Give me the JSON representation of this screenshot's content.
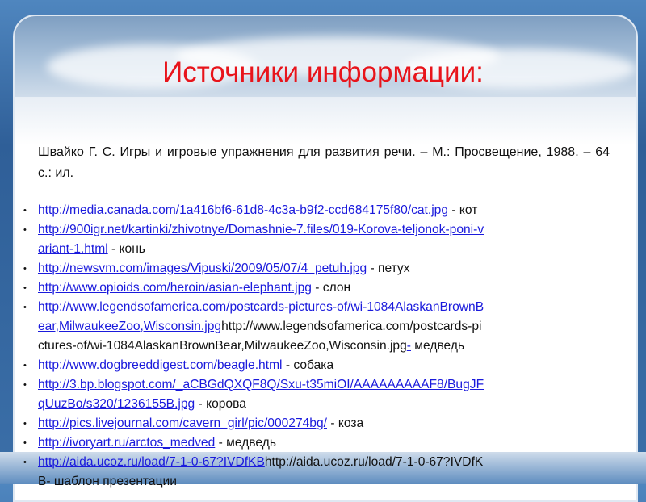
{
  "title": "Источники информации:",
  "reference": "Швайко Г. С.  Игры и игровые упражнения для развития речи. – М.: Просвещение, 1988. – 64 с.: ил.",
  "items": [
    {
      "lines": [
        {
          "link": "http://media.canada.com/1a416bf6-61d8-4c3a-b9f2-ccd684175f80/cat.jpg",
          "text": " - кот"
        }
      ]
    },
    {
      "lines": [
        {
          "link": "http://900igr.net/kartinki/zhivotnye/Domashnie-7.files/019-Korova-teljonok-poni-v",
          "text": ""
        },
        {
          "link": "ariant-1.html",
          "text": " - конь"
        }
      ]
    },
    {
      "lines": [
        {
          "link": "http://newsvm.com/images/Vipuski/2009/05/07/4_petuh.jpg",
          "text": " - петух"
        }
      ]
    },
    {
      "lines": [
        {
          "link": "http://www.opioids.com/heroin/asian-elephant.jpg",
          "text": " - слон"
        }
      ]
    },
    {
      "lines": [
        {
          "link": "http://www.legendsofamerica.com/postcards-pictures-of/wi-1084AlaskanBrownB",
          "text": ""
        },
        {
          "link": "ear,MilwaukeeZoo,Wisconsin.jpg",
          "text": "http://www.legendsofamerica.com/postcards-pi"
        },
        {
          "link": "",
          "text": "ctures-of/wi-1084AlaskanBrownBear,MilwaukeeZoo,Wisconsin.jpg",
          "link2": "-",
          "text2": " медведь"
        }
      ]
    },
    {
      "lines": [
        {
          "link": "http://www.dogbreeddigest.com/beagle.html",
          "text": " - собака"
        }
      ]
    },
    {
      "lines": [
        {
          "link": "http://3.bp.blogspot.com/_aCBGdQXQF8Q/Sxu-t35miOI/AAAAAAAAAF8/BugJF",
          "text": ""
        },
        {
          "link": "qUuzBo/s320/1236155B.jpg",
          "text": " - корова"
        }
      ]
    },
    {
      "lines": [
        {
          "link": "http://pics.livejournal.com/cavern_girl/pic/000274bg/",
          "text": " - коза"
        }
      ]
    },
    {
      "lines": [
        {
          "link": "http://ivoryart.ru/arctos_medved",
          "text": " - медведь"
        }
      ]
    },
    {
      "lines": [
        {
          "link": "http://aida.ucoz.ru/load/7-1-0-67?IVDfKB",
          "text": "http://aida.ucoz.ru/load/7-1-0-67?IVDfK"
        },
        {
          "link": "",
          "text": "B- шаблон презентации"
        }
      ]
    }
  ]
}
